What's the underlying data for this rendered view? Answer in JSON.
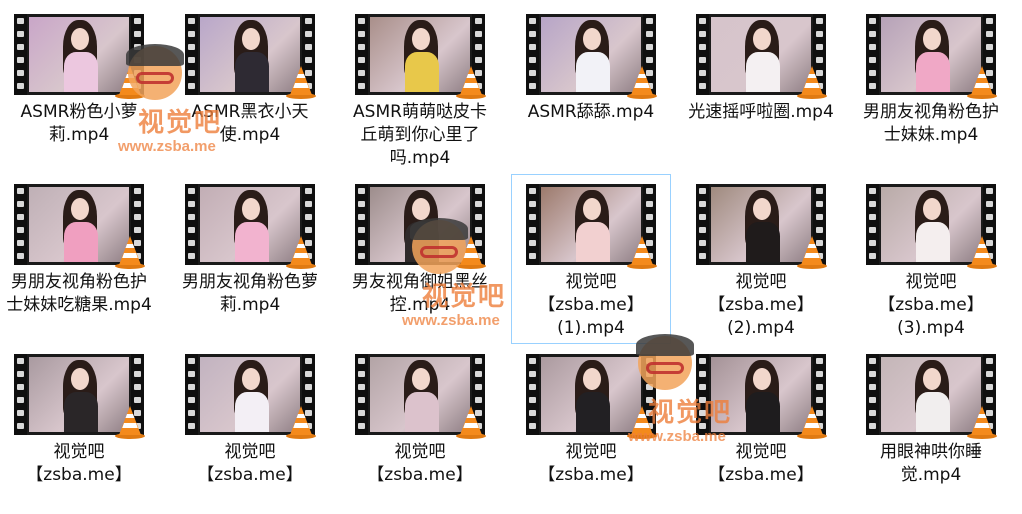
{
  "files": [
    {
      "label": "ASMR粉色小萝莉.mp4",
      "thumb_bg": "#c9a6c8",
      "top": "#ecc7df",
      "selected": false
    },
    {
      "label": "ASMR黑衣小天使.mp4",
      "thumb_bg": "#b9a7c9",
      "top": "#2e2a33",
      "selected": false
    },
    {
      "label": "ASMR萌萌哒皮卡丘萌到你心里了吗.mp4",
      "thumb_bg": "#a98f8a",
      "top": "#e8c84a",
      "selected": false
    },
    {
      "label": "ASMR舔舔.mp4",
      "thumb_bg": "#b7a5c7",
      "top": "#f2f2f7",
      "selected": false
    },
    {
      "label": "光速摇呼啦圈.mp4",
      "thumb_bg": "#d6c4cb",
      "top": "#f4f0f2",
      "selected": false
    },
    {
      "label": "男朋友视角粉色护士妹妹.mp4",
      "thumb_bg": "#b6a2b8",
      "top": "#f0a8c6",
      "selected": false
    },
    {
      "label": "男朋友视角粉色护士妹妹吃糖果.mp4",
      "thumb_bg": "#bfb0b6",
      "top": "#f09fc0",
      "selected": false
    },
    {
      "label": "男朋友视角粉色萝莉.mp4",
      "thumb_bg": "#c2aeb5",
      "top": "#f2b3cf",
      "selected": false
    },
    {
      "label": "男友视角御姐黑丝控.mp4",
      "thumb_bg": "#9d8d8c",
      "top": "#2f2a2a",
      "selected": false
    },
    {
      "label": "视觉吧【zsba.me】(1).mp4",
      "thumb_bg": "#9c7a6c",
      "top": "#f2d0d0",
      "selected": true
    },
    {
      "label": "视觉吧【zsba.me】(2).mp4",
      "thumb_bg": "#9f8a7e",
      "top": "#1f1b1b",
      "selected": false
    },
    {
      "label": "视觉吧【zsba.me】(3).mp4",
      "thumb_bg": "#b9aba8",
      "top": "#f4eeee",
      "selected": false
    },
    {
      "label": "视觉吧【zsba.me】",
      "thumb_bg": "#a99aa0",
      "top": "#2a2628",
      "selected": false
    },
    {
      "label": "视觉吧【zsba.me】",
      "thumb_bg": "#c2b3c0",
      "top": "#f3eff5",
      "selected": false
    },
    {
      "label": "视觉吧【zsba.me】",
      "thumb_bg": "#b3a4a6",
      "top": "#dcc2cc",
      "selected": false
    },
    {
      "label": "视觉吧【zsba.me】",
      "thumb_bg": "#ab9a9f",
      "top": "#222023",
      "selected": false
    },
    {
      "label": "视觉吧【zsba.me】",
      "thumb_bg": "#a49297",
      "top": "#1e1c1e",
      "selected": false
    },
    {
      "label": "用眼神哄你睡觉.mp4",
      "thumb_bg": "#c4b6b8",
      "top": "#f1eeee",
      "selected": false
    }
  ],
  "watermark": {
    "brand": "视觉吧",
    "url": "www.zsba.me"
  },
  "colors": {
    "selection_border": "#99d1ff",
    "watermark": "#ee7f3c",
    "vlc_orange": "#f48a1c"
  }
}
